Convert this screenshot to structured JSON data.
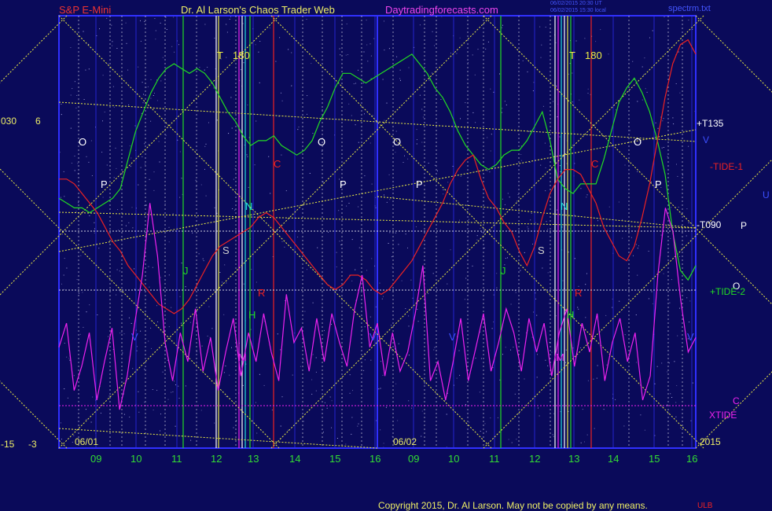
{
  "header": {
    "instrument": "S&P E-Mini",
    "site": "Dr. Al Larson's Chaos Trader Web",
    "url": "Daytradingforecasts.com",
    "stamp1": "06/02/2015 20:30 UT",
    "stamp2": "06/02/2015 15:30 local",
    "file": "spectrm.txt"
  },
  "footer": {
    "copyright": "Copyright 2015, Dr. Al Larson. May not be copied by any means.",
    "ulb": "ULB"
  },
  "colors": {
    "background": "#0a0a5a",
    "axis": "#3030ff",
    "green_line": "#22dd22",
    "red_line": "#ee2222",
    "magenta_line": "#ee22ee",
    "yellow_dotted": "#eeee44",
    "white": "#ffffff"
  },
  "left_scale": {
    "top_left": "030",
    "top_right": "6",
    "bottom_left": "-15",
    "bottom_right": "-3"
  },
  "chart_data": {
    "type": "line",
    "x_ticks": [
      "09",
      "10",
      "11",
      "12",
      "13",
      "14",
      "15",
      "16",
      "09",
      "10",
      "11",
      "12",
      "13",
      "14",
      "15",
      "16"
    ],
    "date_labels": [
      "06/01",
      "06/02"
    ],
    "year_label": "2015",
    "right_labels": [
      {
        "text": "+T135",
        "color": "#ffffff"
      },
      {
        "text": "V",
        "color": "#3c50ff"
      },
      {
        "text": "-TIDE-1",
        "color": "#ee2222"
      },
      {
        "text": "U",
        "color": "#3c50ff"
      },
      {
        "text": "-T090",
        "color": "#ffffff"
      },
      {
        "text": "P",
        "color": "#ffffff"
      },
      {
        "text": "O",
        "color": "#ffffff"
      },
      {
        "text": "+TIDE-2",
        "color": "#22dd22"
      },
      {
        "text": "C",
        "color": "#ee22ee"
      },
      {
        "text": "XTIDE",
        "color": "#ee22ee"
      }
    ],
    "event_markers": [
      {
        "text": "T",
        "color": "#eeee44"
      },
      {
        "text": "180",
        "color": "#eeee44"
      },
      {
        "text": "T",
        "color": "#eeee44"
      },
      {
        "text": "180",
        "color": "#eeee44"
      },
      {
        "text": "O",
        "color": "#ffffff"
      },
      {
        "text": "O",
        "color": "#ffffff"
      },
      {
        "text": "O",
        "color": "#ffffff"
      },
      {
        "text": "O",
        "color": "#ffffff"
      },
      {
        "text": "P",
        "color": "#ffffff"
      },
      {
        "text": "P",
        "color": "#ffffff"
      },
      {
        "text": "P",
        "color": "#ffffff"
      },
      {
        "text": "P",
        "color": "#ffffff"
      },
      {
        "text": "C",
        "color": "#ee2222"
      },
      {
        "text": "C",
        "color": "#ee2222"
      },
      {
        "text": "N",
        "color": "#22dddd"
      },
      {
        "text": "N",
        "color": "#22dddd"
      },
      {
        "text": "S",
        "color": "#cccccc"
      },
      {
        "text": "S",
        "color": "#cccccc"
      },
      {
        "text": "J",
        "color": "#22dd22"
      },
      {
        "text": "J",
        "color": "#22dd22"
      },
      {
        "text": "H",
        "color": "#22dd22"
      },
      {
        "text": "H",
        "color": "#22dd22"
      },
      {
        "text": "R",
        "color": "#ee2222"
      },
      {
        "text": "R",
        "color": "#ee2222"
      },
      {
        "text": "M",
        "color": "#ee22ee"
      },
      {
        "text": "M",
        "color": "#ee22ee"
      },
      {
        "text": "V",
        "color": "#3c50ff"
      },
      {
        "text": "V",
        "color": "#3c50ff"
      },
      {
        "text": "V",
        "color": "#3c50ff"
      },
      {
        "text": "V",
        "color": "#3c50ff"
      }
    ],
    "series": [
      {
        "color": "#22dd22",
        "values": [
          2.2,
          2.1,
          2.0,
          2.0,
          1.9,
          2.0,
          2.1,
          2.2,
          2.4,
          3.0,
          3.6,
          4.0,
          4.4,
          4.7,
          4.9,
          5.0,
          4.9,
          4.8,
          4.9,
          4.8,
          4.6,
          4.3,
          4.0,
          3.8,
          3.5,
          3.3,
          3.4,
          3.4,
          3.5,
          3.3,
          3.2,
          3.1,
          3.2,
          3.4,
          3.8,
          4.1,
          4.5,
          4.8,
          4.8,
          4.7,
          4.6,
          4.7,
          4.8,
          4.9,
          5.0,
          5.1,
          5.2,
          5.0,
          4.8,
          4.5,
          4.3,
          4.0,
          3.6,
          3.3,
          3.1,
          2.9,
          2.8,
          2.9,
          3.1,
          3.2,
          3.2,
          3.4,
          3.7,
          4.0,
          3.4,
          2.6,
          2.4,
          2.3,
          2.5,
          2.5,
          2.5,
          3.0,
          3.6,
          4.2,
          4.5,
          4.7,
          4.4,
          4.0,
          3.4,
          2.7,
          1.5,
          0.7,
          0.5,
          0.8
        ]
      },
      {
        "color": "#ee2222",
        "values": [
          2.6,
          2.6,
          2.5,
          2.3,
          2.1,
          1.9,
          1.6,
          1.3,
          1.1,
          0.8,
          0.6,
          0.4,
          0.2,
          0.0,
          -0.1,
          -0.2,
          -0.1,
          0.1,
          0.4,
          0.7,
          1.0,
          1.2,
          1.3,
          1.4,
          1.5,
          1.6,
          1.8,
          1.9,
          1.8,
          1.6,
          1.4,
          1.2,
          1.0,
          0.8,
          0.6,
          0.4,
          0.3,
          0.4,
          0.6,
          0.6,
          0.5,
          0.3,
          0.2,
          0.3,
          0.5,
          0.7,
          0.9,
          1.2,
          1.5,
          1.8,
          2.1,
          2.5,
          2.8,
          3.0,
          3.1,
          2.6,
          2.2,
          2.0,
          1.7,
          1.5,
          1.1,
          0.8,
          1.2,
          1.8,
          2.3,
          2.6,
          2.8,
          2.8,
          2.7,
          2.4,
          2.1,
          1.6,
          1.3,
          1.0,
          0.9,
          1.2,
          1.8,
          2.5,
          3.4,
          4.3,
          5.0,
          5.4,
          5.5,
          5.2
        ]
      },
      {
        "color": "#ee22ee",
        "values": [
          -0.9,
          -0.4,
          -1.8,
          -1.3,
          -0.6,
          -2.0,
          -1.2,
          -0.5,
          -2.2,
          -1.5,
          -0.4,
          0.6,
          2.1,
          1.0,
          -0.8,
          -1.6,
          -0.6,
          -1.2,
          -0.1,
          -1.4,
          -0.7,
          -1.8,
          -1.0,
          -0.3,
          -1.5,
          -0.6,
          -1.2,
          -0.2,
          -1.0,
          -1.6,
          0.2,
          -0.8,
          -0.5,
          -1.4,
          -0.3,
          -1.2,
          -0.2,
          -0.8,
          -1.3,
          -0.1,
          0.6,
          -0.9,
          -0.4,
          -1.5,
          -0.6,
          -1.4,
          -1.0,
          -0.2,
          0.8,
          -1.6,
          -1.2,
          -2.0,
          -1.2,
          -0.3,
          -1.6,
          -0.9,
          -0.2,
          -1.4,
          -0.8,
          -0.1,
          -0.6,
          -1.4,
          -0.3,
          -1.0,
          -0.4,
          -1.5,
          -0.6,
          -0.1,
          -1.3,
          -0.4,
          -1.0,
          -0.2,
          -1.6,
          -0.8,
          -0.3,
          -1.2,
          -0.6,
          -2.0,
          -1.5,
          0.6,
          2.0,
          1.5,
          0.1,
          -1.0,
          -0.7
        ]
      }
    ]
  }
}
